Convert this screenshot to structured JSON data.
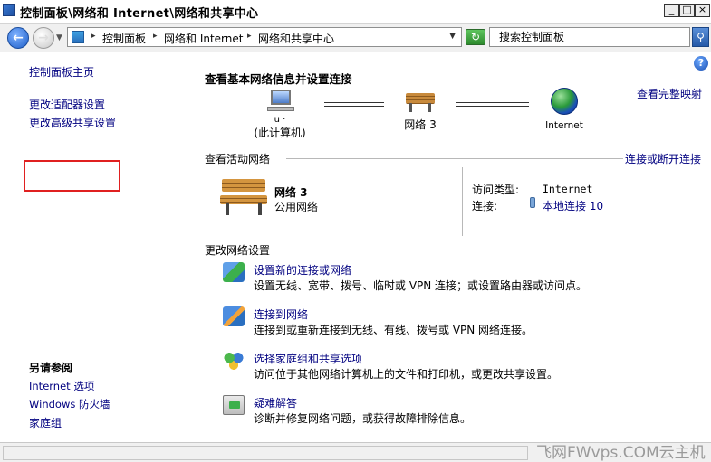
{
  "window": {
    "title": "控制面板\\网络和 Internet\\网络和共享中心",
    "minimize_label": "_",
    "maximize_label": "□",
    "close_label": "×"
  },
  "addressbar": {
    "crumbs": [
      "控制面板",
      "网络和 Internet",
      "网络和共享中心"
    ],
    "search_placeholder": "搜索控制面板"
  },
  "sidebar": {
    "links": [
      "控制面板主页",
      "更改适配器设置",
      "更改高级共享设置"
    ],
    "see_also_title": "另请参阅",
    "see_also_links": [
      "Internet 选项",
      "Windows 防火墙",
      "家庭组"
    ]
  },
  "main": {
    "title": "查看基本网络信息并设置连接",
    "full_map_link": "查看完整映射",
    "network_map": {
      "computer_name": "u          ·",
      "computer_label": "(此计算机)",
      "network_label": "网络   3",
      "internet_label": "Internet"
    },
    "active_networks": {
      "title": "查看活动网络",
      "connect_link": "连接或断开连接",
      "network_name": "网络    3",
      "network_type": "公用网络",
      "access_type_key": "访问类型:",
      "access_type_value": "Internet",
      "connections_key": "连接:",
      "connections_value": "本地连接 10"
    },
    "change_settings": {
      "title": "更改网络设置",
      "tasks": [
        {
          "icon": "new-connection-icon",
          "link": "设置新的连接或网络",
          "desc": "设置无线、宽带、拨号、临时或 VPN 连接；或设置路由器或访问点。"
        },
        {
          "icon": "connect-network-icon",
          "link": "连接到网络",
          "desc": "连接到或重新连接到无线、有线、拨号或 VPN 网络连接。"
        },
        {
          "icon": "homegroup-icon",
          "link": "选择家庭组和共享选项",
          "desc": "访问位于其他网络计算机上的文件和打印机，或更改共享设置。"
        },
        {
          "icon": "troubleshoot-icon",
          "link": "疑难解答",
          "desc": "诊断并修复网络问题，或获得故障排除信息。"
        }
      ]
    }
  },
  "watermark": "飞网FWvps.COM云主机",
  "colors": {
    "link": "#000080",
    "highlight_border": "#e02020"
  }
}
